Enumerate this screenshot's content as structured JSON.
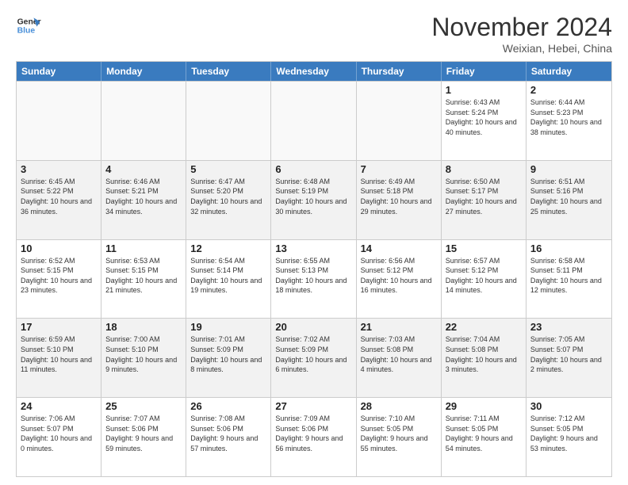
{
  "logo": {
    "line1": "General",
    "line2": "Blue"
  },
  "title": "November 2024",
  "subtitle": "Weixian, Hebei, China",
  "days": [
    "Sunday",
    "Monday",
    "Tuesday",
    "Wednesday",
    "Thursday",
    "Friday",
    "Saturday"
  ],
  "weeks": [
    [
      {
        "day": "",
        "text": ""
      },
      {
        "day": "",
        "text": ""
      },
      {
        "day": "",
        "text": ""
      },
      {
        "day": "",
        "text": ""
      },
      {
        "day": "",
        "text": ""
      },
      {
        "day": "1",
        "text": "Sunrise: 6:43 AM\nSunset: 5:24 PM\nDaylight: 10 hours and 40 minutes."
      },
      {
        "day": "2",
        "text": "Sunrise: 6:44 AM\nSunset: 5:23 PM\nDaylight: 10 hours and 38 minutes."
      }
    ],
    [
      {
        "day": "3",
        "text": "Sunrise: 6:45 AM\nSunset: 5:22 PM\nDaylight: 10 hours and 36 minutes."
      },
      {
        "day": "4",
        "text": "Sunrise: 6:46 AM\nSunset: 5:21 PM\nDaylight: 10 hours and 34 minutes."
      },
      {
        "day": "5",
        "text": "Sunrise: 6:47 AM\nSunset: 5:20 PM\nDaylight: 10 hours and 32 minutes."
      },
      {
        "day": "6",
        "text": "Sunrise: 6:48 AM\nSunset: 5:19 PM\nDaylight: 10 hours and 30 minutes."
      },
      {
        "day": "7",
        "text": "Sunrise: 6:49 AM\nSunset: 5:18 PM\nDaylight: 10 hours and 29 minutes."
      },
      {
        "day": "8",
        "text": "Sunrise: 6:50 AM\nSunset: 5:17 PM\nDaylight: 10 hours and 27 minutes."
      },
      {
        "day": "9",
        "text": "Sunrise: 6:51 AM\nSunset: 5:16 PM\nDaylight: 10 hours and 25 minutes."
      }
    ],
    [
      {
        "day": "10",
        "text": "Sunrise: 6:52 AM\nSunset: 5:15 PM\nDaylight: 10 hours and 23 minutes."
      },
      {
        "day": "11",
        "text": "Sunrise: 6:53 AM\nSunset: 5:15 PM\nDaylight: 10 hours and 21 minutes."
      },
      {
        "day": "12",
        "text": "Sunrise: 6:54 AM\nSunset: 5:14 PM\nDaylight: 10 hours and 19 minutes."
      },
      {
        "day": "13",
        "text": "Sunrise: 6:55 AM\nSunset: 5:13 PM\nDaylight: 10 hours and 18 minutes."
      },
      {
        "day": "14",
        "text": "Sunrise: 6:56 AM\nSunset: 5:12 PM\nDaylight: 10 hours and 16 minutes."
      },
      {
        "day": "15",
        "text": "Sunrise: 6:57 AM\nSunset: 5:12 PM\nDaylight: 10 hours and 14 minutes."
      },
      {
        "day": "16",
        "text": "Sunrise: 6:58 AM\nSunset: 5:11 PM\nDaylight: 10 hours and 12 minutes."
      }
    ],
    [
      {
        "day": "17",
        "text": "Sunrise: 6:59 AM\nSunset: 5:10 PM\nDaylight: 10 hours and 11 minutes."
      },
      {
        "day": "18",
        "text": "Sunrise: 7:00 AM\nSunset: 5:10 PM\nDaylight: 10 hours and 9 minutes."
      },
      {
        "day": "19",
        "text": "Sunrise: 7:01 AM\nSunset: 5:09 PM\nDaylight: 10 hours and 8 minutes."
      },
      {
        "day": "20",
        "text": "Sunrise: 7:02 AM\nSunset: 5:09 PM\nDaylight: 10 hours and 6 minutes."
      },
      {
        "day": "21",
        "text": "Sunrise: 7:03 AM\nSunset: 5:08 PM\nDaylight: 10 hours and 4 minutes."
      },
      {
        "day": "22",
        "text": "Sunrise: 7:04 AM\nSunset: 5:08 PM\nDaylight: 10 hours and 3 minutes."
      },
      {
        "day": "23",
        "text": "Sunrise: 7:05 AM\nSunset: 5:07 PM\nDaylight: 10 hours and 2 minutes."
      }
    ],
    [
      {
        "day": "24",
        "text": "Sunrise: 7:06 AM\nSunset: 5:07 PM\nDaylight: 10 hours and 0 minutes."
      },
      {
        "day": "25",
        "text": "Sunrise: 7:07 AM\nSunset: 5:06 PM\nDaylight: 9 hours and 59 minutes."
      },
      {
        "day": "26",
        "text": "Sunrise: 7:08 AM\nSunset: 5:06 PM\nDaylight: 9 hours and 57 minutes."
      },
      {
        "day": "27",
        "text": "Sunrise: 7:09 AM\nSunset: 5:06 PM\nDaylight: 9 hours and 56 minutes."
      },
      {
        "day": "28",
        "text": "Sunrise: 7:10 AM\nSunset: 5:05 PM\nDaylight: 9 hours and 55 minutes."
      },
      {
        "day": "29",
        "text": "Sunrise: 7:11 AM\nSunset: 5:05 PM\nDaylight: 9 hours and 54 minutes."
      },
      {
        "day": "30",
        "text": "Sunrise: 7:12 AM\nSunset: 5:05 PM\nDaylight: 9 hours and 53 minutes."
      }
    ]
  ]
}
